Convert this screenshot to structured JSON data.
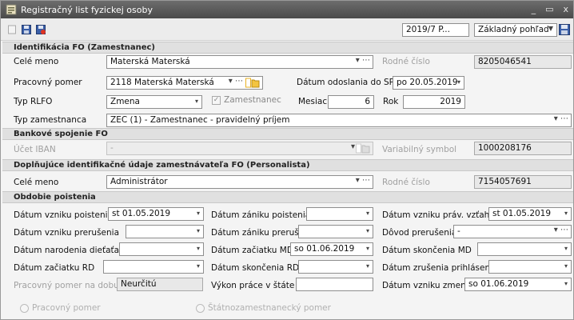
{
  "window": {
    "title": "Registračný list fyzickej osoby",
    "minimize": "_",
    "maximize": "▭",
    "close": "x"
  },
  "toolbar": {
    "period": "2019/7 P...",
    "view": "Základný pohľad"
  },
  "sections": {
    "identifikacia": "Identifikácia FO (Zamestnanec)",
    "bank": "Bankové spojenie FO",
    "doplnujuce": "Doplňujúce identifikačné údaje zamestnávateľa FO (Personalista)",
    "obdobie": "Obdobie poistenia"
  },
  "ident": {
    "cele_meno_label": "Celé meno",
    "cele_meno": "Materská Materská",
    "rodne_cislo_label": "Rodné číslo",
    "rodne_cislo": "8205046541",
    "pracovny_pomer_label": "Pracovný pomer",
    "pracovny_pomer": "2118 Materská Materská",
    "datum_odoslania_label": "Dátum odoslania do SP",
    "datum_odoslania": "po 20.05.2019",
    "typ_rlfo_label": "Typ RLFO",
    "typ_rlfo": "Zmena",
    "zamestnanec_label": "Zamestnanec",
    "mesiac_label": "Mesiac",
    "mesiac": "6",
    "rok_label": "Rok",
    "rok": "2019",
    "typ_zam_label": "Typ zamestnanca",
    "typ_zam": "ZEC (1) - Zamestnanec - pravidelný príjem"
  },
  "bank": {
    "iban_label": "Účet IBAN",
    "iban": "-",
    "vs_label": "Variabilný symbol",
    "vs": "1000208176"
  },
  "dopl": {
    "cele_meno_label": "Celé meno",
    "cele_meno": "Administrátor",
    "rodne_cislo_label": "Rodné číslo",
    "rodne_cislo": "7154057691"
  },
  "obd": {
    "vznik_poist_label": "Dátum vzniku poistenia",
    "vznik_poist": "st 01.05.2019",
    "zanik_poist_label": "Dátum zániku poistenia",
    "zanik_poist": "",
    "vznik_prav_label": "Dátum vzniku práv. vzťahu",
    "vznik_prav": "st 01.05.2019",
    "vznik_prer_label": "Dátum vzniku prerušenia",
    "vznik_prer": "",
    "zanik_prer_label": "Dátum zániku prerušenia",
    "zanik_prer": "",
    "dovod_prer_label": "Dôvod prerušenia",
    "dovod_prer": "-",
    "nar_dieta_label": "Dátum narodenia dieťaťa",
    "nar_dieta": "",
    "zac_md_label": "Dátum začiatku MD",
    "zac_md": "so 01.06.2019",
    "skon_md_label": "Dátum skončenia MD",
    "skon_md": "",
    "zac_rd_label": "Dátum začiatku RD",
    "zac_rd": "",
    "skon_rd_label": "Dátum skončenia RD",
    "skon_rd": "",
    "zrus_prihl_label": "Dátum zrušenia prihlásenia",
    "zrus_prihl": "",
    "prac_doba_label": "Pracovný pomer na dobu",
    "prac_doba": "Neurčitú",
    "vykon_label": "Výkon práce v štáte",
    "vykon": "",
    "vznik_zmeny_label": "Dátum vzniku zmeny",
    "vznik_zmeny": "so 01.06.2019"
  },
  "radios": {
    "pracovny": "Pracovný pomer",
    "statnozam": "Štátnozamestnanecký pomer"
  },
  "colors": {
    "titlebar": "#4a4a4a",
    "section": "#e0e0e0",
    "folder": "#e8b020"
  }
}
